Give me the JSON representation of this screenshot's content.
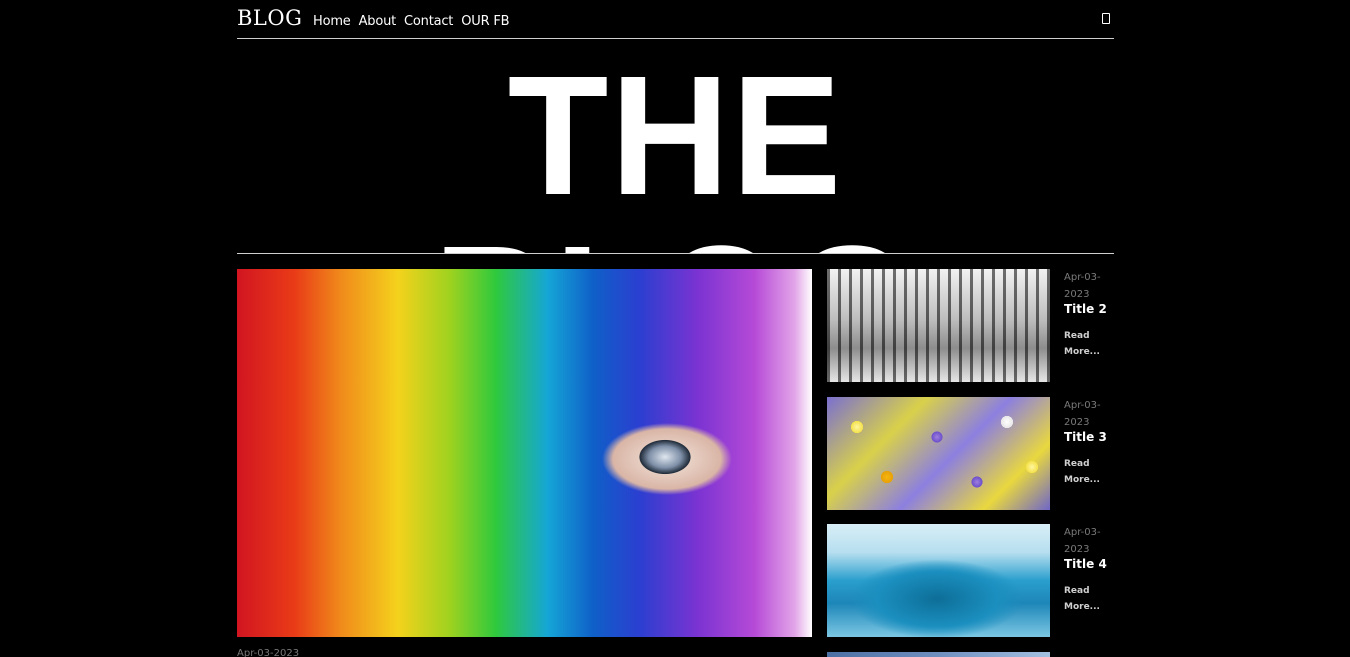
{
  "header": {
    "logo": "BLOG",
    "nav": [
      "Home",
      "About",
      "Contact",
      "OUR FB"
    ],
    "menu_icon": "mobile-icon"
  },
  "hero": {
    "title": "THE BLOG"
  },
  "feature": {
    "date": "Apr-03-2023"
  },
  "sidebar_posts": [
    {
      "date": "Apr-03-2023",
      "title": "Title 2",
      "read_more": "Read More..."
    },
    {
      "date": "Apr-03-2023",
      "title": "Title 3",
      "read_more": "Read More..."
    },
    {
      "date": "Apr-03-2023",
      "title": "Title 4",
      "read_more": "Read More..."
    }
  ]
}
